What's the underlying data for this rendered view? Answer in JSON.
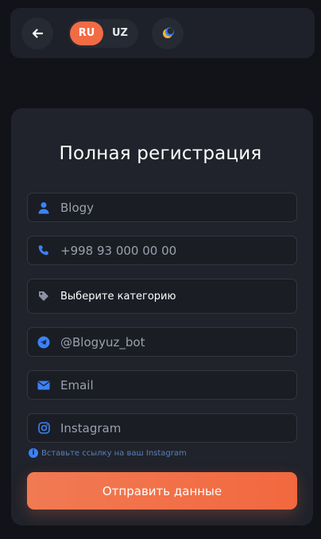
{
  "header": {
    "languages": [
      {
        "code": "RU",
        "active": true
      },
      {
        "code": "UZ",
        "active": false
      }
    ]
  },
  "form": {
    "title": "Полная регистрация",
    "fields": {
      "name": {
        "placeholder": "Blogy",
        "icon": "user-icon"
      },
      "phone": {
        "placeholder": "+998 93 000 00 00",
        "icon": "phone-icon"
      },
      "category": {
        "value": "Выберите категорию",
        "icon": "tag-icon"
      },
      "telegram": {
        "placeholder": "@Blogyuz_bot",
        "icon": "telegram-icon"
      },
      "email": {
        "placeholder": "Email",
        "icon": "envelope-icon"
      },
      "instagram": {
        "placeholder": "Instagram",
        "icon": "instagram-icon"
      }
    },
    "instagram_hint": "Вставьте ссылку на ваш Instagram",
    "submit_label": "Отправить данные"
  },
  "colors": {
    "accent": "#f26b44",
    "icon_blue": "#3b82f6",
    "background": "#111318",
    "card": "#20232b"
  }
}
